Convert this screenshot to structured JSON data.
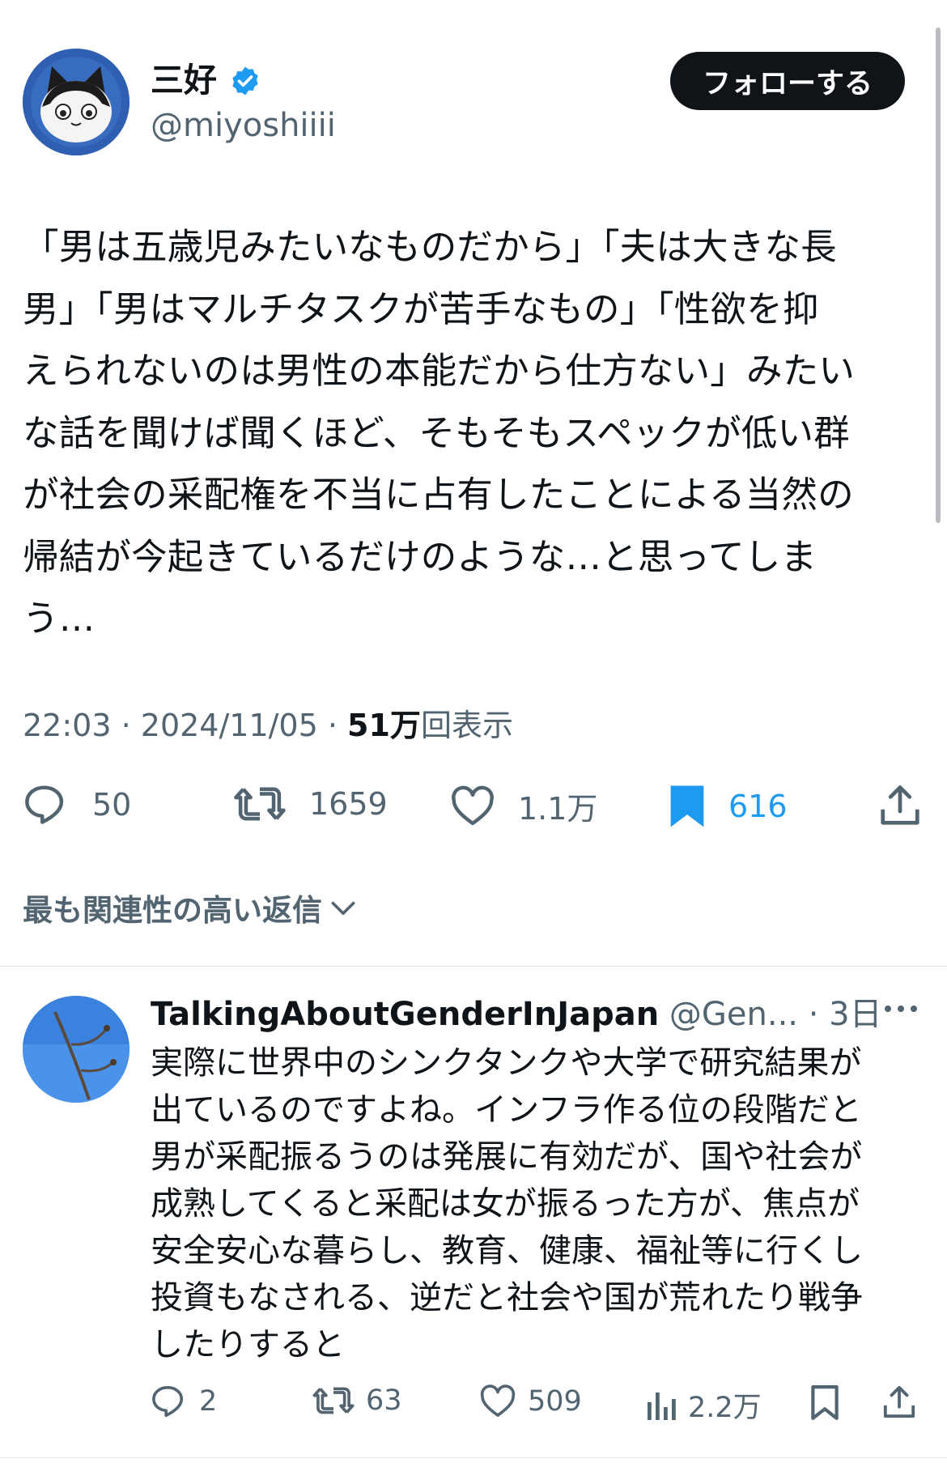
{
  "author": {
    "name": "三好",
    "handle": "@miyoshiiii",
    "verified": true,
    "avatar_icon": "cat-avatar",
    "follow_label": "フォローする"
  },
  "post": {
    "text": "「男は五歳児みたいなものだから」「夫は大きな長\n男」「男はマルチタスクが苦手なもの」「性欲を抑\nえられないのは男性の本能だから仕方ない」みたい\nな話を聞けば聞くほど、そもそもスペックが低い群\nが社会の采配権を不当に占有したことによる当然の\n帰結が今起きているだけのような…と思ってしま\nう…",
    "time": "22:03",
    "separator": " · ",
    "date": "2024/11/05",
    "views_count": "51万",
    "views_label": "回表示"
  },
  "actions": {
    "replies": "50",
    "reposts": "1659",
    "likes": "1.1万",
    "bookmarks": "616"
  },
  "sort_label": "最も関連性の高い返信",
  "reply": {
    "name": "TalkingAboutGenderInJapan",
    "handle": "@Gen...",
    "time": "3日",
    "more_icon": "more-dots-icon",
    "text": "実際に世界中のシンクタンクや大学で研究結果が\n出ているのですよね。インフラ作る位の段階だと\n男が采配振るうのは発展に有効だが、国や社会が\n成熟してくると采配は女が振るった方が、焦点が\n安全安心な暮らし、教育、健康、福祉等に行くし\n投資もなされる、逆だと社会や国が荒れたり戦争\nしたりすると",
    "replies": "2",
    "reposts": "63",
    "likes": "509",
    "views": "2.2万"
  },
  "colors": {
    "accent": "#1d9bf0",
    "text": "#0f1419",
    "secondary": "#536471",
    "follow_bg": "#0f1419"
  }
}
